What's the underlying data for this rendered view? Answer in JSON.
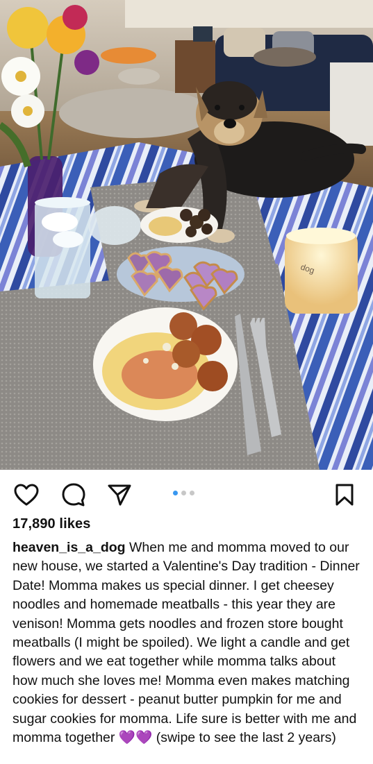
{
  "post": {
    "image_alt": "Dog sitting on a picnic blanket in front of a Valentine's dinner with spaghetti, meatballs, heart cookies, flowers and a candle",
    "candle_label": "dog",
    "carousel": {
      "count": 3,
      "active_index": 0
    },
    "actions": {
      "like_icon": "heart-outline-icon",
      "comment_icon": "comment-bubble-icon",
      "share_icon": "paper-plane-icon",
      "save_icon": "bookmark-icon"
    },
    "likes_text": "17,890 likes",
    "caption": {
      "username": "heaven_is_a_dog",
      "text": "When me and momma moved to our new house, we started a Valentine's Day tradition - Dinner Date! Momma makes us special dinner. I get cheesey noodles and homemade meatballs - this year they are venison! Momma gets noodles and frozen store bought meatballs (I might be spoiled). We light a candle and get flowers and we eat together while momma talks about how much she loves me! Momma even makes matching cookies for dessert - peanut butter pumpkin for me and sugar cookies for momma. Life sure is better with me and momma together ",
      "emoji": "💜💜",
      "tail": " (swipe to see the last 2 years)"
    }
  }
}
